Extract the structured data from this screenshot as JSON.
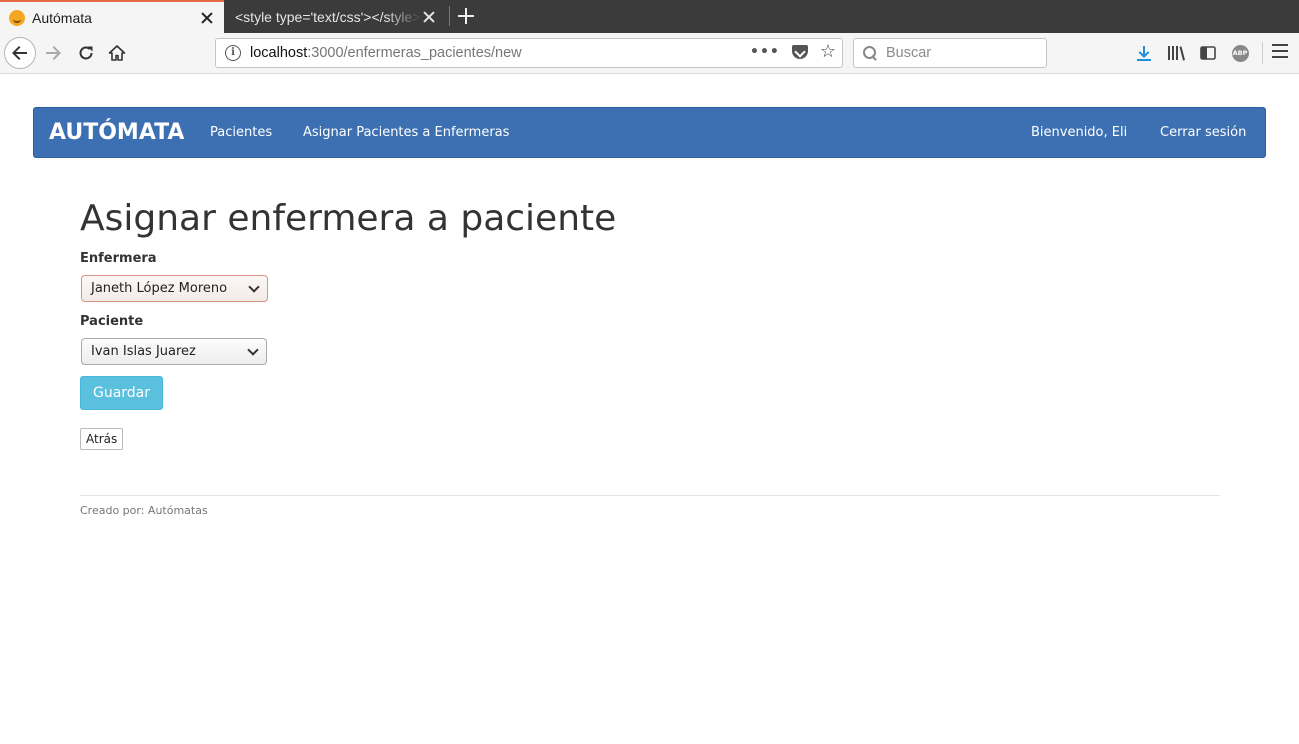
{
  "browser": {
    "tabs": [
      {
        "title": "Autómata",
        "active": true
      },
      {
        "title": "<style type='text/css'></style>",
        "active": false
      }
    ],
    "url": {
      "host": "localhost",
      "path": ":3000/enfermeras_pacientes/new"
    },
    "search": {
      "placeholder": "Buscar"
    },
    "icons": [
      "back-icon",
      "forward-icon",
      "reload-icon",
      "home-icon",
      "info-icon",
      "more-dots-icon",
      "pocket-icon",
      "star-icon",
      "search-icon",
      "download-icon",
      "library-icon",
      "sidebar-icon",
      "adblock-icon",
      "hamburger-menu-icon"
    ],
    "colors": {
      "active_tab_accent": "#e66a43",
      "download_icon": "#1f8ee0"
    }
  },
  "app": {
    "brand": "AUTÓMATA",
    "nav": {
      "pacientes": "Pacientes",
      "asignar": "Asignar Pacientes a Enfermeras",
      "bienvenido": "Bienvenido, Eli",
      "cerrar": "Cerrar sesión"
    },
    "colors": {
      "navbar": "#3d70b2",
      "primary_button": "#5bc0de"
    }
  },
  "form": {
    "title": "Asignar enfermera a paciente",
    "enfermera_label": "Enfermera",
    "enfermera_value": "Janeth López Moreno",
    "paciente_label": "Paciente",
    "paciente_value": "Ivan Islas Juarez",
    "submit_label": "Guardar",
    "back_label": "Atrás"
  },
  "footer": {
    "text": "Creado por: Autómatas"
  }
}
